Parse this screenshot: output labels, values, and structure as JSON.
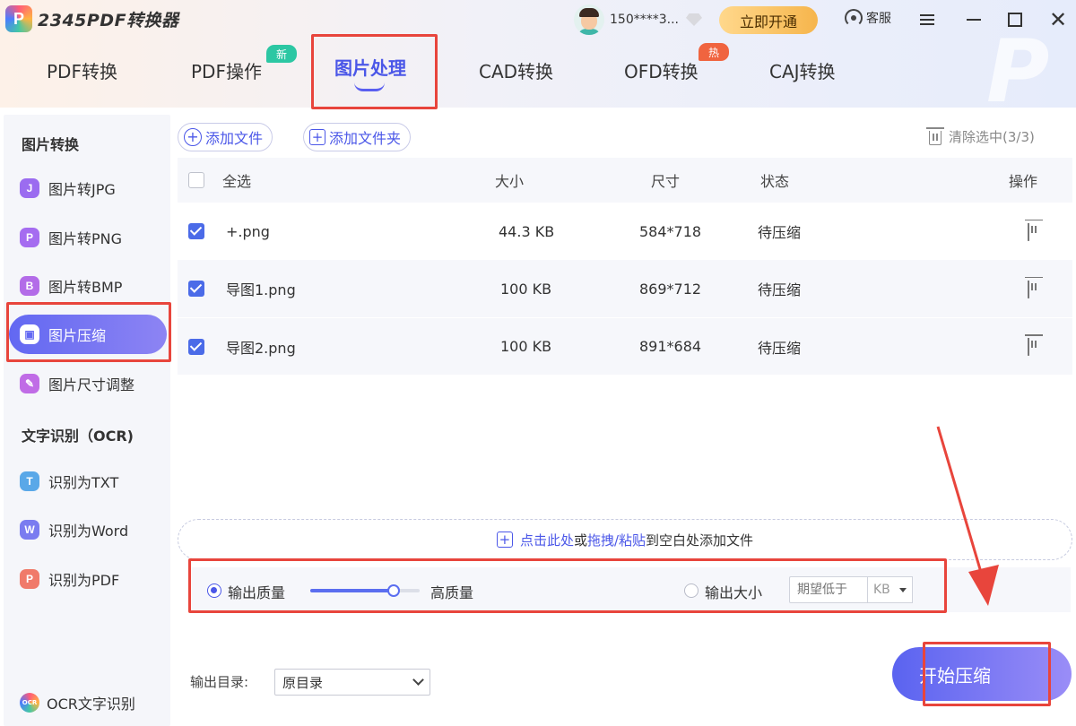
{
  "app": {
    "logo_letter": "P",
    "logo_text": "2345PDF转换器"
  },
  "user": {
    "name": "150****3...",
    "vip_label": "立即开通",
    "service_label": "客服"
  },
  "tabs": [
    {
      "label": "PDF转换"
    },
    {
      "label": "PDF操作",
      "badge": "新"
    },
    {
      "label": "图片处理",
      "active": true
    },
    {
      "label": "CAD转换"
    },
    {
      "label": "OFD转换",
      "badge": "热"
    },
    {
      "label": "CAJ转换"
    }
  ],
  "sidebar": {
    "section1": "图片转换",
    "items1": [
      {
        "icon": "J",
        "label": "图片转JPG",
        "color": "#9b6cf0"
      },
      {
        "icon": "P",
        "label": "图片转PNG",
        "color": "#a56cf0"
      },
      {
        "icon": "B",
        "label": "图片转BMP",
        "color": "#b36ce8"
      },
      {
        "icon": "▣",
        "label": "图片压缩",
        "active": true
      },
      {
        "icon": "✎",
        "label": "图片尺寸调整",
        "color": "#c06ce6"
      }
    ],
    "section2": "文字识别（OCR)",
    "items2": [
      {
        "icon": "T",
        "label": "识别为TXT",
        "color": "#5aa8e8"
      },
      {
        "icon": "W",
        "label": "识别为Word",
        "color": "#7a7cf0"
      },
      {
        "icon": "P",
        "label": "识别为PDF",
        "color": "#f07a6a"
      }
    ],
    "footer_badge": "OCR",
    "footer_label": "OCR文字识别"
  },
  "toolbar": {
    "add_file": "添加文件",
    "add_folder": "添加文件夹",
    "clear": "清除选中(3/3)"
  },
  "table": {
    "headers": {
      "select_all": "全选",
      "size": "大小",
      "dims": "尺寸",
      "status": "状态",
      "action": "操作"
    },
    "rows": [
      {
        "name": "+.png",
        "size": "44.3 KB",
        "dims": "584*718",
        "status": "待压缩",
        "checked": true
      },
      {
        "name": "导图1.png",
        "size": "100 KB",
        "dims": "869*712",
        "status": "待压缩",
        "checked": true
      },
      {
        "name": "导图2.png",
        "size": "100 KB",
        "dims": "891*684",
        "status": "待压缩",
        "checked": true
      }
    ]
  },
  "dropzone": {
    "part1": "点击此处",
    "part2": "或",
    "part3": "拖拽/粘贴",
    "part4": "到空白处添加文件"
  },
  "options": {
    "quality_label": "输出质量",
    "quality_level": 0.76,
    "quality_value_label": "高质量",
    "size_label": "输出大小",
    "size_placeholder": "期望低于",
    "size_unit": "KB"
  },
  "output": {
    "label": "输出目录:",
    "selected": "原目录"
  },
  "start_button": "开始压缩",
  "colors": {
    "accent": "#4b57e8",
    "highlight": "#e8453c"
  }
}
